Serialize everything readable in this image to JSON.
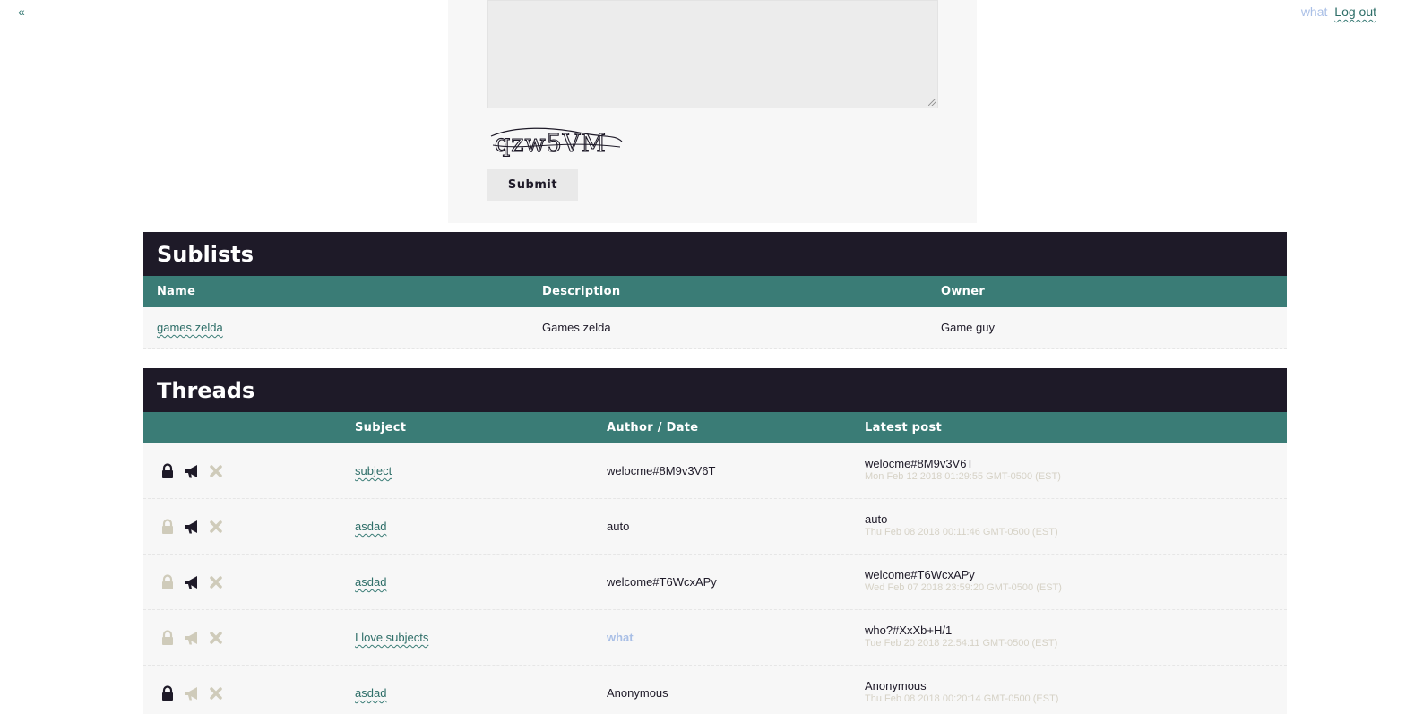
{
  "nav": {
    "back_label": "«"
  },
  "user": {
    "name": "what",
    "logout_label": "Log out"
  },
  "form": {
    "captcha_text": "qzw5VM",
    "submit_label": "Submit"
  },
  "colors": {
    "header_dark": "#1e1a28",
    "header_teal": "#3a7c76",
    "link": "#2e6e68",
    "active_icon": "#1e1a28",
    "inactive_icon": "#cfcbba"
  },
  "sublists": {
    "title": "Sublists",
    "columns": {
      "name": "Name",
      "description": "Description",
      "owner": "Owner"
    },
    "rows": [
      {
        "name": "games.zelda",
        "description": "Games zelda",
        "owner": "Game guy"
      }
    ]
  },
  "threads": {
    "title": "Threads",
    "columns": {
      "subject": "Subject",
      "author_date": "Author / Date",
      "latest": "Latest post"
    },
    "rows": [
      {
        "locked": true,
        "announced": true,
        "subject": "subject",
        "author": "welocme#8M9v3V6T",
        "latest_author": "welocme#8M9v3V6T",
        "latest_date": "Mon Feb 12 2018 01:29:55 GMT-0500 (EST)"
      },
      {
        "locked": false,
        "announced": true,
        "subject": "asdad",
        "author": "auto",
        "latest_author": "auto",
        "latest_date": "Thu Feb 08 2018 00:11:46 GMT-0500 (EST)"
      },
      {
        "locked": false,
        "announced": true,
        "subject": "asdad",
        "author": "welcome#T6WcxAPy",
        "latest_author": "welcome#T6WcxAPy",
        "latest_date": "Wed Feb 07 2018 23:59:20 GMT-0500 (EST)"
      },
      {
        "locked": false,
        "announced": false,
        "subject": "I love subjects",
        "author": "what",
        "latest_author": "who?#XxXb+H/1",
        "latest_date": "Tue Feb 20 2018 22:54:11 GMT-0500 (EST)"
      },
      {
        "locked": true,
        "announced": false,
        "subject": "asdad",
        "author": "Anonymous",
        "latest_author": "Anonymous",
        "latest_date": "Thu Feb 08 2018 00:20:14 GMT-0500 (EST)"
      }
    ]
  }
}
